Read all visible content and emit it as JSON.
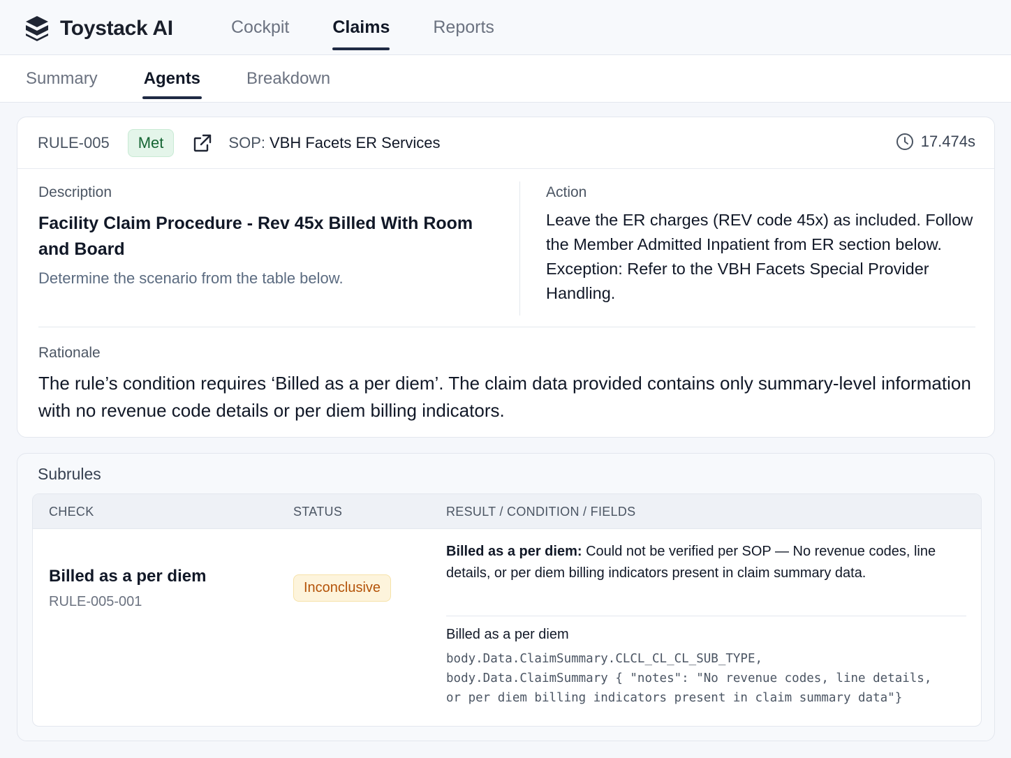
{
  "app": {
    "name": "Toystack AI"
  },
  "top_nav": [
    {
      "label": "Cockpit",
      "active": false
    },
    {
      "label": "Claims",
      "active": true
    },
    {
      "label": "Reports",
      "active": false
    }
  ],
  "sub_nav": [
    {
      "label": "Summary",
      "active": false
    },
    {
      "label": "Agents",
      "active": true
    },
    {
      "label": "Breakdown",
      "active": false
    }
  ],
  "rule": {
    "id": "RULE-005",
    "status": "Met",
    "sop_label": "SOP:",
    "sop_value": "VBH Facets ER Services",
    "duration": "17.474s",
    "description_label": "Description",
    "description_title": "Facility Claim Procedure - Rev 45x Billed With Room and Board",
    "description_sub": "Determine the scenario from the table below.",
    "action_label": "Action",
    "action_text": "Leave the ER charges (REV code 45x) as included. Follow the Member Admitted Inpatient from ER section below. Exception: Refer to the VBH Facets Special Provider Handling.",
    "rationale_label": "Rationale",
    "rationale_text": "The rule’s condition requires ‘Billed as a per diem’. The claim data provided contains only summary-level information with no revenue code details or per diem billing indicators."
  },
  "subrules": {
    "title": "Subrules",
    "columns": [
      "CHECK",
      "STATUS",
      "RESULT / CONDITION / FIELDS"
    ],
    "rows": [
      {
        "check_name": "Billed as a per diem",
        "check_id": "RULE-005-001",
        "status": "Inconclusive",
        "result_bold": "Billed as a per diem:",
        "result_text": " Could not be verified per SOP — No revenue codes, line details, or per diem billing indicators present in claim summary data.",
        "fields_label": "Billed as a per diem",
        "fields_code_1": "body.Data.ClaimSummary.CLCL_CL_CL_SUB_TYPE,",
        "fields_code_2": "body.Data.ClaimSummary { \"notes\": \"No revenue codes, line details,",
        "fields_code_3": "or per diem billing indicators present in claim summary data\"}"
      }
    ]
  },
  "colors": {
    "met_bg": "#e4f5ea",
    "met_text": "#166534",
    "inconclusive_bg": "#fdf4dc",
    "inconclusive_text": "#b45309",
    "nav_underline": "#1f2a44"
  },
  "icons": {
    "logo": "layered-cube-logo-icon",
    "external": "external-link-icon",
    "timer": "clock-icon"
  }
}
